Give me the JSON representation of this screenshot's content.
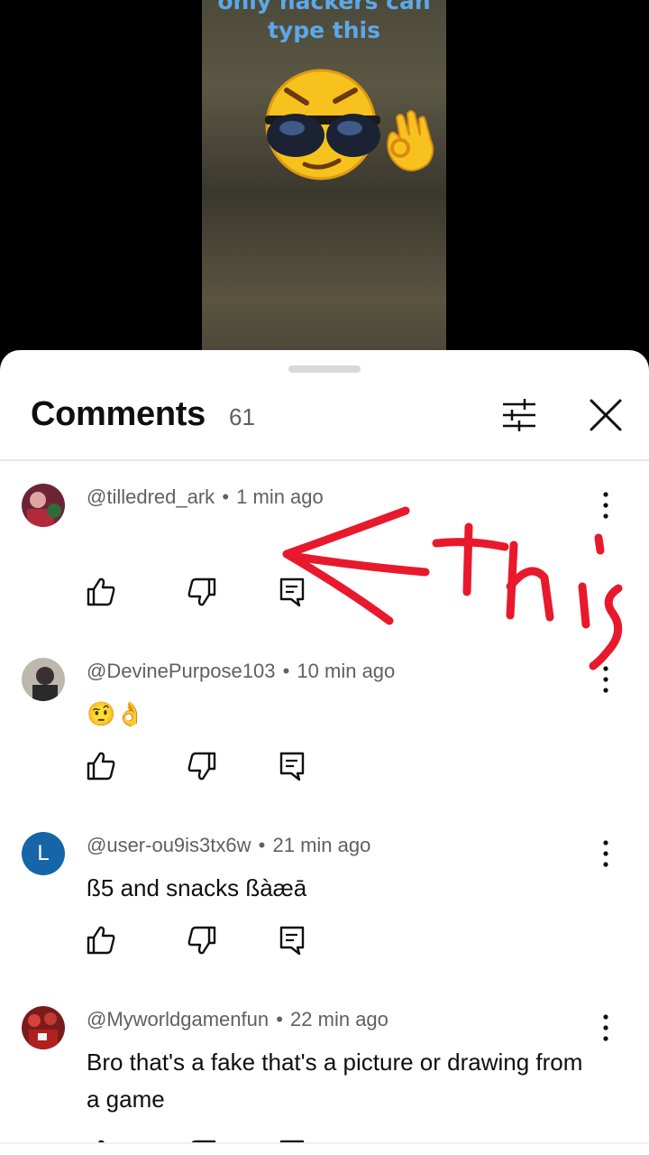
{
  "video": {
    "caption": "only hackers can\ntype this"
  },
  "comments_panel": {
    "title": "Comments",
    "count": "61"
  },
  "comments": [
    {
      "handle": "@tilledred_ark",
      "time": "1 min ago",
      "text": ""
    },
    {
      "handle": "@DevinePurpose103",
      "time": "10 min ago",
      "text": "🤨👌"
    },
    {
      "handle": "@user-ou9is3tx6w",
      "time": "21 min ago",
      "text": "ß5 and snacks ßàæā",
      "avatar_letter": "L"
    },
    {
      "handle": "@Myworldgamenfun",
      "time": "22 min ago",
      "text": "Bro that's a fake that's a picture or drawing from a game"
    }
  ],
  "separator": "•",
  "annotation": {
    "text": "this",
    "color": "#e8192c"
  },
  "colors": {
    "caption": "#5da8e8",
    "avatar_letter_bg": "#1565a8",
    "meta_text": "#606060"
  },
  "icons": [
    "filter-icon",
    "close-icon",
    "more-vert-icon",
    "thumb-up-icon",
    "thumb-down-icon",
    "reply-icon"
  ]
}
